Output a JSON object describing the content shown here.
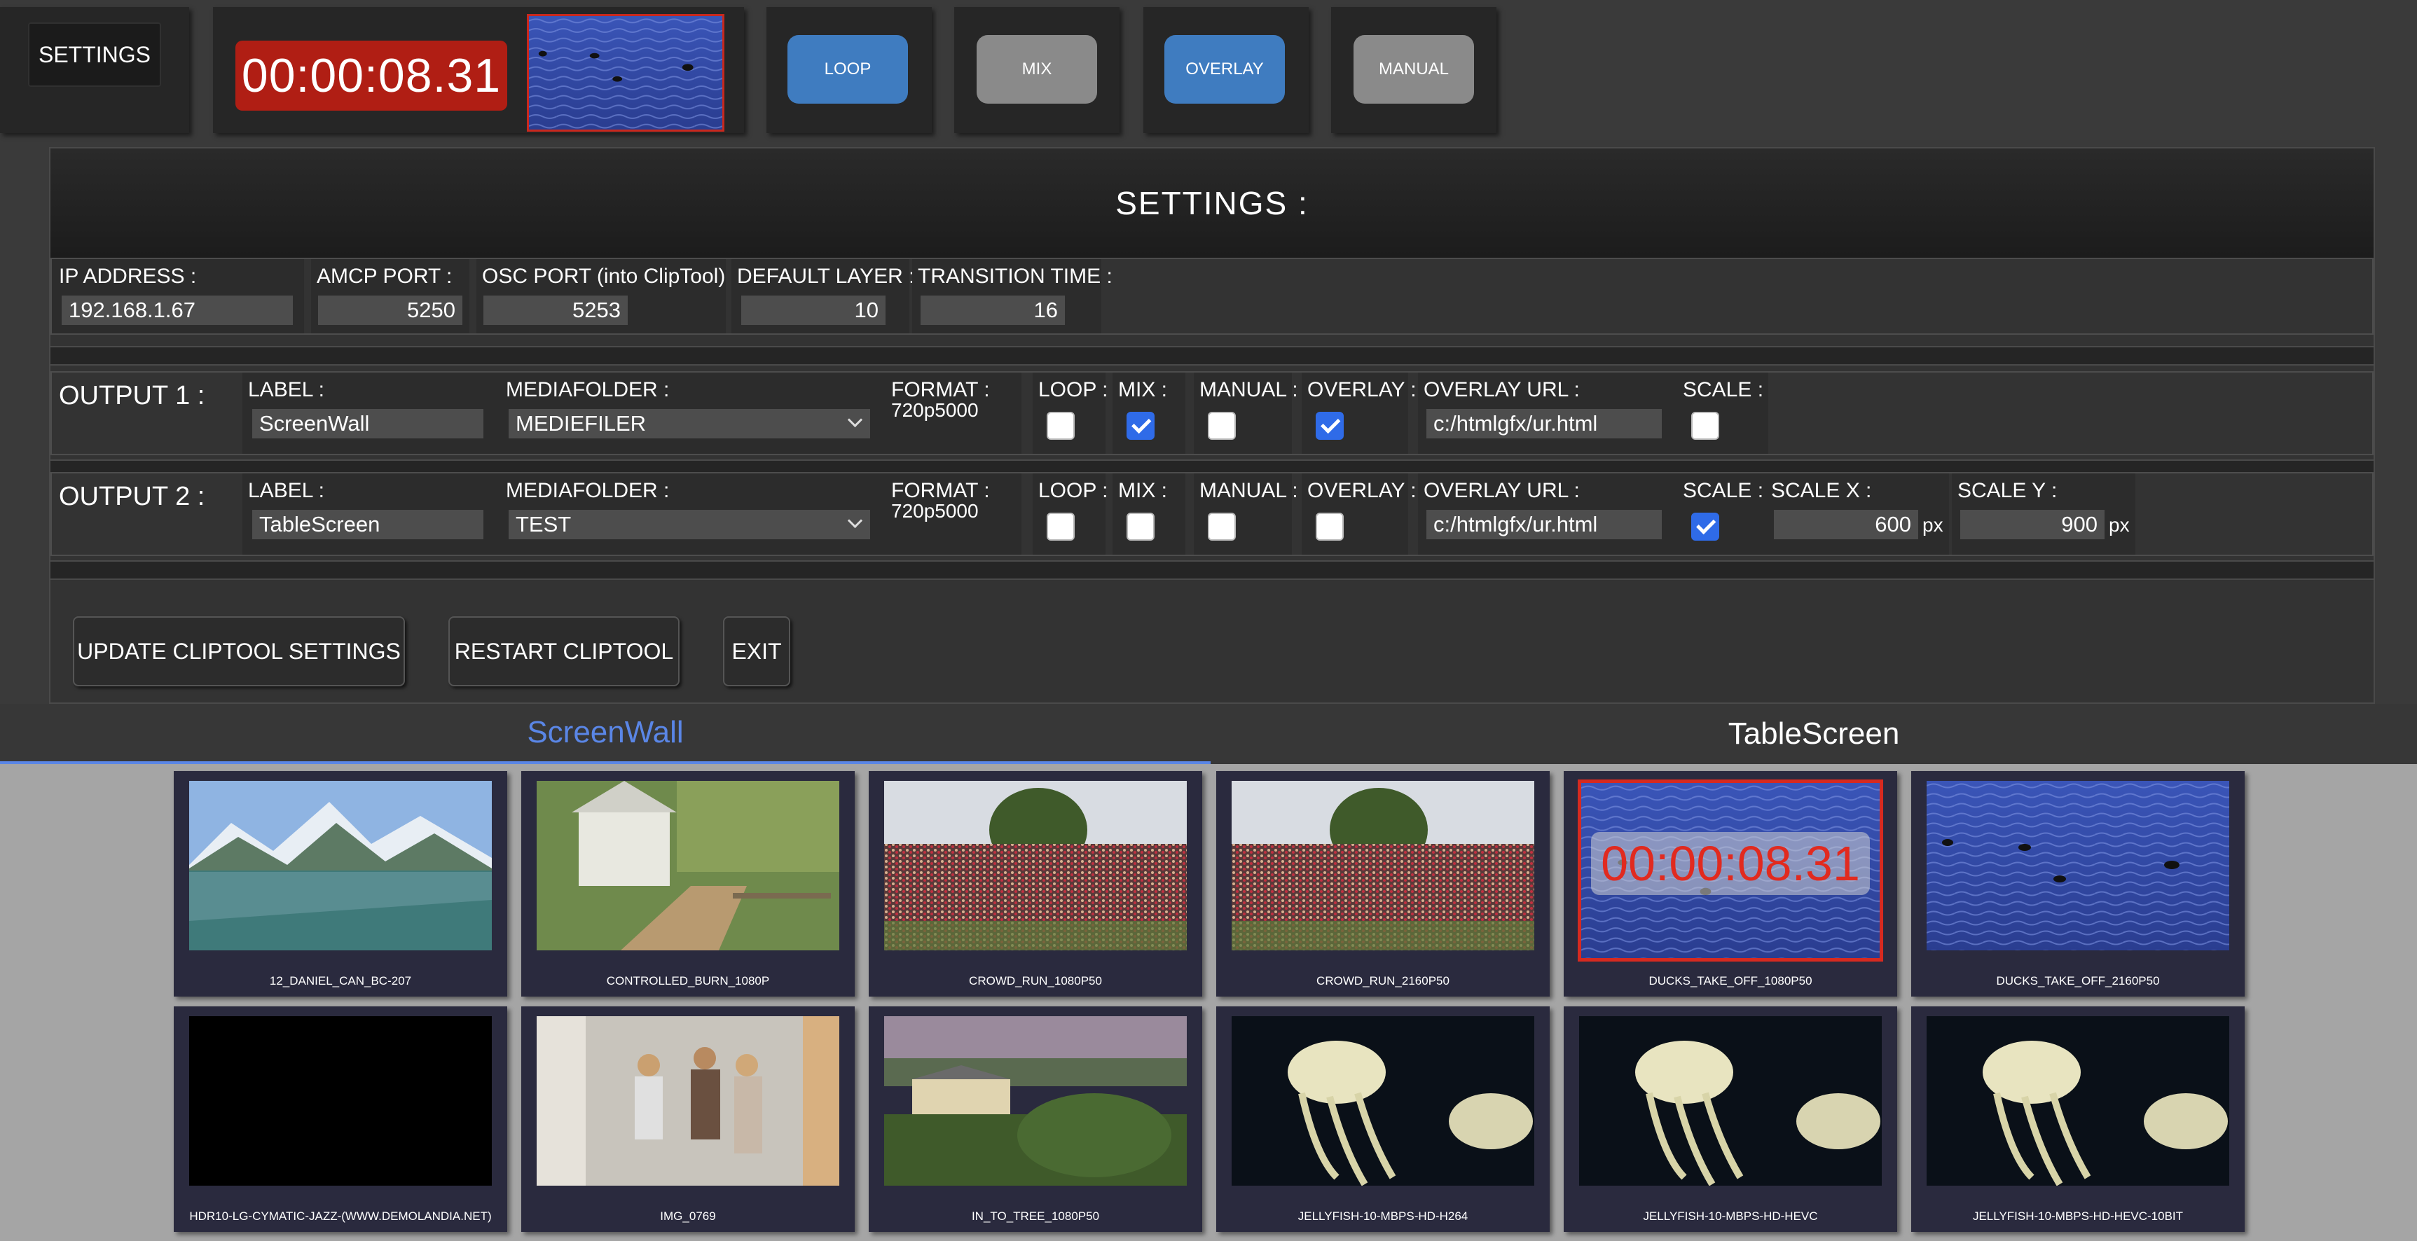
{
  "topbar": {
    "settings_label": "SETTINGS",
    "timecode": "00:00:08.31",
    "modes": [
      {
        "label": "LOOP",
        "state": "active"
      },
      {
        "label": "MIX",
        "state": "inactive"
      },
      {
        "label": "OVERLAY",
        "state": "active"
      },
      {
        "label": "MANUAL",
        "state": "inactive"
      }
    ]
  },
  "settings": {
    "title": "SETTINGS :",
    "ip_label": "IP ADDRESS :",
    "ip_value": "192.168.1.67",
    "amcp_label": "AMCP PORT :",
    "amcp_value": "5250",
    "osc_label": "OSC PORT (into ClipTool) :",
    "osc_value": "5253",
    "layer_label": "DEFAULT LAYER :",
    "layer_value": "10",
    "transition_label": "TRANSITION TIME :",
    "transition_value": "16"
  },
  "output1": {
    "title": "OUTPUT 1 :",
    "label_label": "LABEL :",
    "label_value": "ScreenWall",
    "folder_label": "MEDIAFOLDER :",
    "folder_value": "MEDIEFILER",
    "format_label": "FORMAT :",
    "format_value": "720p5000",
    "loop_label": "LOOP :",
    "loop": false,
    "mix_label": "MIX :",
    "mix": true,
    "manual_label": "MANUAL :",
    "manual": false,
    "overlay_label": "OVERLAY :",
    "overlay": true,
    "overlay_url_label": "OVERLAY URL :",
    "overlay_url": "c:/htmlgfx/ur.html",
    "scale_label": "SCALE :",
    "scale": false
  },
  "output2": {
    "title": "OUTPUT 2 :",
    "label_label": "LABEL :",
    "label_value": "TableScreen",
    "folder_label": "MEDIAFOLDER :",
    "folder_value": "TEST",
    "format_label": "FORMAT :",
    "format_value": "720p5000",
    "loop_label": "LOOP :",
    "loop": false,
    "mix_label": "MIX :",
    "mix": false,
    "manual_label": "MANUAL :",
    "manual": false,
    "overlay_label": "OVERLAY :",
    "overlay": false,
    "overlay_url_label": "OVERLAY URL :",
    "overlay_url": "c:/htmlgfx/ur.html",
    "scale_label": "SCALE :",
    "scale": true,
    "scale_x_label": "SCALE X :",
    "scale_x": "600",
    "scale_y_label": "SCALE Y :",
    "scale_y": "900",
    "unit": "px"
  },
  "actions": {
    "update": "UPDATE CLIPTOOL SETTINGS",
    "restart": "RESTART CLIPTOOL",
    "exit": "EXIT"
  },
  "tabs": [
    {
      "label": "ScreenWall",
      "active": true
    },
    {
      "label": "TableScreen",
      "active": false
    }
  ],
  "clips": [
    {
      "name": "12_DANIEL_CAN_BC-207"
    },
    {
      "name": "CONTROLLED_BURN_1080P"
    },
    {
      "name": "CROWD_RUN_1080P50"
    },
    {
      "name": "CROWD_RUN_2160P50"
    },
    {
      "name": "DUCKS_TAKE_OFF_1080P50",
      "playing": true,
      "overlay_timecode": "00:00:08.31"
    },
    {
      "name": "DUCKS_TAKE_OFF_2160P50"
    },
    {
      "name": "HDR10-LG-CYMATIC-JAZZ-(WWW.DEMOLANDIA.NET)"
    },
    {
      "name": "IMG_0769"
    },
    {
      "name": "IN_TO_TREE_1080P50"
    },
    {
      "name": "JELLYFISH-10-MBPS-HD-H264"
    },
    {
      "name": "JELLYFISH-10-MBPS-HD-HEVC"
    },
    {
      "name": "JELLYFISH-10-MBPS-HD-HEVC-10BIT"
    }
  ],
  "colors": {
    "accent_blue": "#3f7cc0",
    "tab_active": "#5a86e6",
    "timecode_red": "#b01e14",
    "checkbox_blue": "#2f6be8"
  }
}
